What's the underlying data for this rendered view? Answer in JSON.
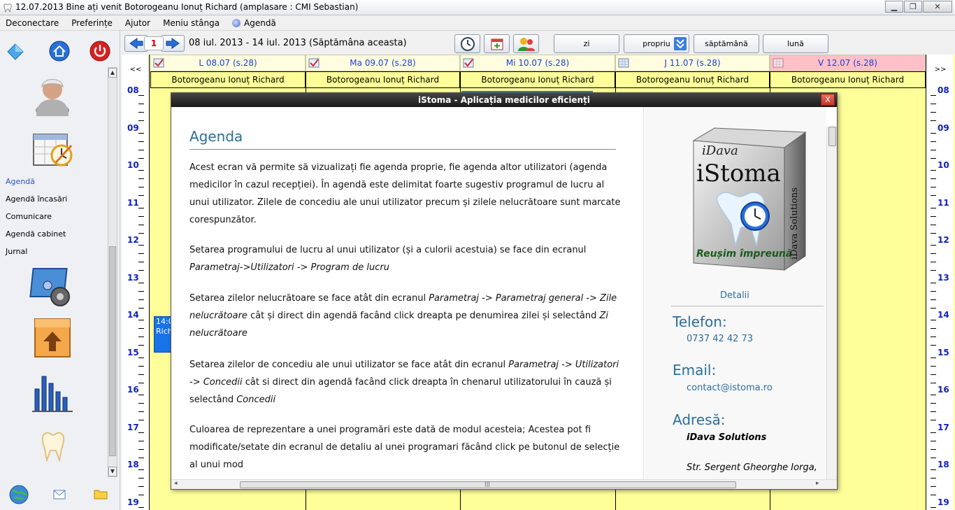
{
  "window": {
    "title": "12.07.2013 Bine ați venit Botorogeanu Ionuț Richard (amplasare : CMI Sebastian)"
  },
  "menu": [
    {
      "label": "Deconectare"
    },
    {
      "label": "Preferințe"
    },
    {
      "label": "Ajutor"
    },
    {
      "label": "Meniu stânga"
    },
    {
      "label": "Agendă"
    }
  ],
  "sidebar": {
    "items": [
      {
        "label": "Agendă",
        "active": true
      },
      {
        "label": "Agendă încasări",
        "active": false
      },
      {
        "label": "Comunicare",
        "active": false
      },
      {
        "label": "Agendă cabinet",
        "active": false
      },
      {
        "label": "Jurnal",
        "active": false
      }
    ]
  },
  "toolbar": {
    "week_counter": "1",
    "week_range": "08 iul. 2013 - 14 iul. 2013 (Săptămâna aceasta)",
    "views": [
      {
        "label": "zi"
      },
      {
        "label": "propriu"
      },
      {
        "label": "săptămână"
      },
      {
        "label": "lună"
      }
    ]
  },
  "calendar": {
    "nav_prev": "<<",
    "nav_next": ">>",
    "days": [
      {
        "label": "L 08.07 (s.28)",
        "user": "Botorogeanu Ionuț Richard",
        "checked": true,
        "today": false
      },
      {
        "label": "Ma 09.07 (s.28)",
        "user": "Botorogeanu Ionuț Richard",
        "checked": true,
        "today": false
      },
      {
        "label": "Mi 10.07 (s.28)",
        "user": "Botorogeanu Ionuț Richard",
        "checked": true,
        "today": false
      },
      {
        "label": "J 11.07 (s.28)",
        "user": "Botorogeanu Ionuț Richard",
        "checked": false,
        "today": false
      },
      {
        "label": "V 12.07 (s.28)",
        "user": "Botorogeanu Ionuț Richard",
        "checked": false,
        "today": true
      }
    ],
    "hours": [
      "08",
      "09",
      "10",
      "11",
      "12",
      "13",
      "14",
      "15",
      "16",
      "17",
      "18",
      "19"
    ],
    "appointment": {
      "line1": "14:0",
      "line2": "Rich"
    }
  },
  "dialog": {
    "title": "iStoma - Aplicația medicilor eficienți",
    "close": "X",
    "heading": "Agenda",
    "paragraphs": [
      "Acest ecran vă permite să vizualizați fie agenda proprie, fie agenda altor utilizatori (agenda medicilor în cazul recepției). În agendă este delimitat foarte sugestiv programul de lucru al unui utilizator. Zilele de concediu ale unui utilizator precum și zilele nelucrătoare sunt marcate corespunzător.",
      "Setarea programului de lucru al unui utilizator (și a culorii acestuia) se face din ecranul",
      "Parametraj->Utilizatori -> Program de lucru",
      "Setarea zilelor nelucrătoare se face atât din ecranul",
      "Parametraj -> Parametraj general -> Zile nelucrătoare",
      "cât și direct din agendă facând click dreapta pe denumirea zilei și selectând",
      "Zi nelucrătoare",
      "Setarea zilelor de concediu ale unui utilizator se face atât din ecranul",
      "Parametraj -> Utilizatori -> Concedii",
      "cât si direct din agendă facând click dreapta în chenarul utilizatorului în cauză și selectând",
      "Concedii",
      "Culoarea de reprezentare a unei programări este dată de modul acesteia; Acestea pot fi modificate/setate din ecranul de detaliu al unei programari făcând click pe butonul de selecție al unui mod"
    ],
    "logo": {
      "brand": "iDava",
      "product": "iStoma",
      "side": "iDava Solutions",
      "slogan": "Reușim împreună"
    },
    "details_link": "Detalii",
    "phone_label": "Telefon:",
    "phone": "0737 42 42 73",
    "email_label": "Email:",
    "email": "contact@istoma.ro",
    "address_label": "Adresă:",
    "company": "iDava Solutions",
    "street": "Str. Sergent Gheorghe Iorga,"
  },
  "colors": {
    "calendar_bg": "#ffff99",
    "today_header": "#ffc0c8",
    "hour_label": "#1020c0",
    "accent": "#2a6f9e"
  }
}
